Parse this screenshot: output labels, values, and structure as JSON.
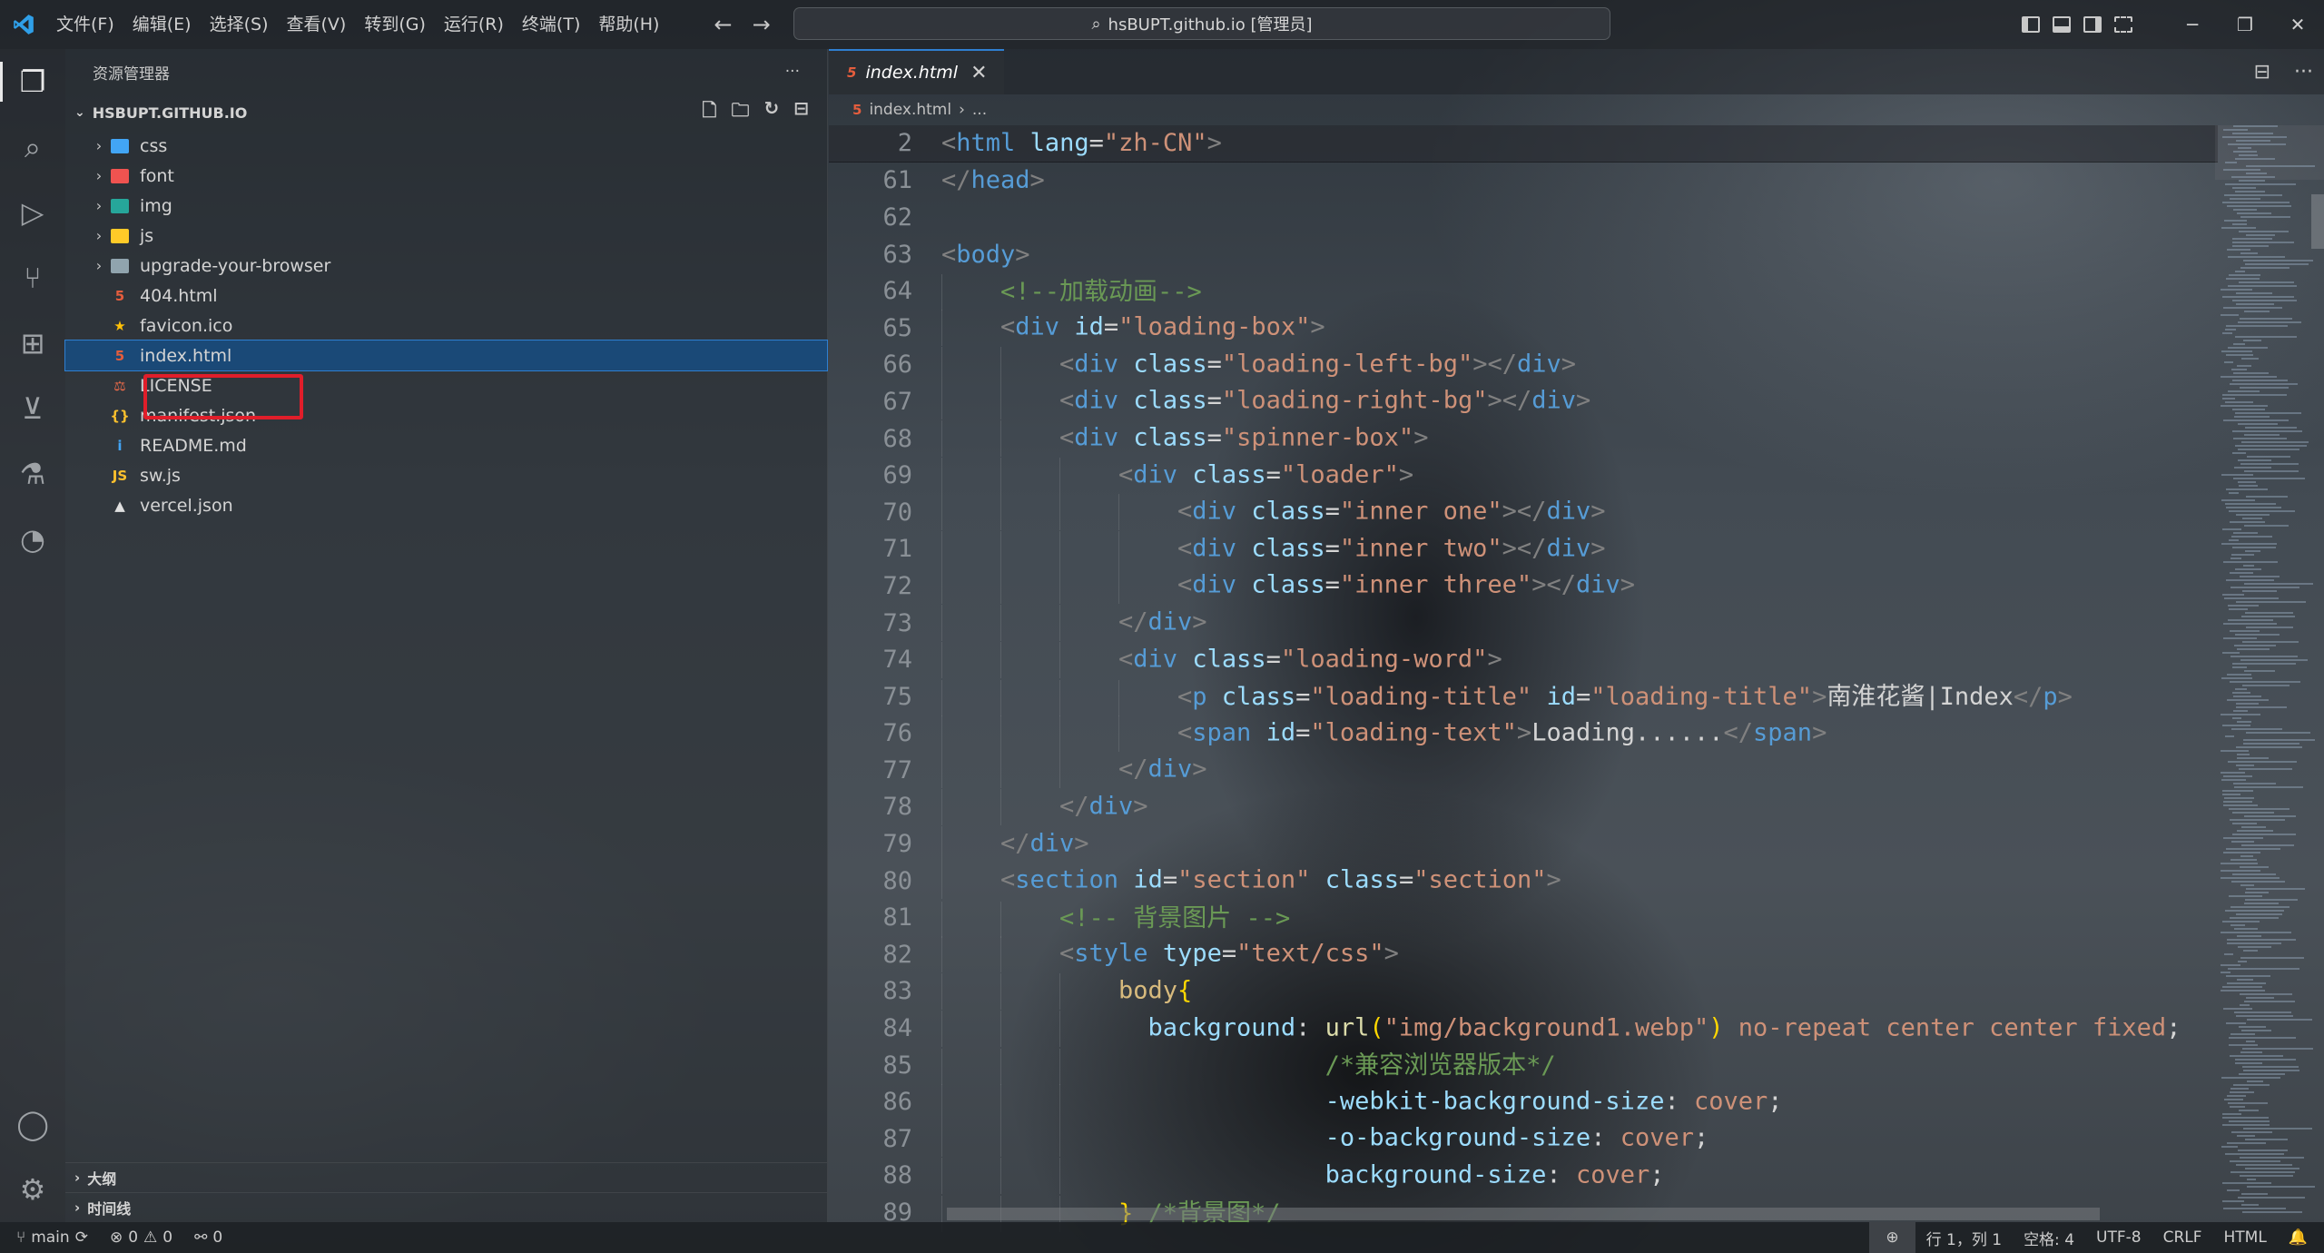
{
  "titlebar": {
    "menu": [
      "文件(F)",
      "编辑(E)",
      "选择(S)",
      "查看(V)",
      "转到(G)",
      "运行(R)",
      "终端(T)",
      "帮助(H)"
    ],
    "back_arrow": "←",
    "forward_arrow": "→",
    "search_text": "hsBUPT.github.io [管理员]",
    "minimize": "─",
    "restore": "❐",
    "close": "✕"
  },
  "activity": {
    "items": [
      "explorer-icon",
      "search-icon",
      "run-debug-icon",
      "source-control-icon",
      "extensions-icon",
      "remote-explorer-icon",
      "testing-icon",
      "live-share-icon"
    ],
    "bottom": [
      "account-icon",
      "settings-gear-icon"
    ]
  },
  "sidebar": {
    "title": "资源管理器",
    "more": "···",
    "root": "HSBUPT.GITHUB.IO",
    "tree": [
      {
        "label": "css",
        "type": "folder",
        "color": "#42a5f5"
      },
      {
        "label": "font",
        "type": "folder",
        "color": "#ef5350"
      },
      {
        "label": "img",
        "type": "folder",
        "color": "#26a69a"
      },
      {
        "label": "js",
        "type": "folder",
        "color": "#ffca28"
      },
      {
        "label": "upgrade-your-browser",
        "type": "folder",
        "color": "#90a4ae"
      },
      {
        "label": "404.html",
        "type": "html",
        "glyph": "5",
        "color": "#e45d3d"
      },
      {
        "label": "favicon.ico",
        "type": "file",
        "glyph": "★",
        "color": "#ffc107"
      },
      {
        "label": "index.html",
        "type": "html",
        "glyph": "5",
        "color": "#e45d3d",
        "selected": true
      },
      {
        "label": "LICENSE",
        "type": "file",
        "glyph": "⚖",
        "color": "#ef6c4a"
      },
      {
        "label": "manifest.json",
        "type": "file",
        "glyph": "{}",
        "color": "#fbc02d"
      },
      {
        "label": "README.md",
        "type": "file",
        "glyph": "i",
        "color": "#42a5f5"
      },
      {
        "label": "sw.js",
        "type": "file",
        "glyph": "JS",
        "color": "#fbc02d"
      },
      {
        "label": "vercel.json",
        "type": "file",
        "glyph": "▲",
        "color": "#e0e0e0"
      }
    ],
    "outline": "大纲",
    "timeline": "时间线"
  },
  "editor": {
    "tab_label": "index.html",
    "tab_close": "✕",
    "breadcrumb_file": "index.html",
    "breadcrumb_sep": "›",
    "breadcrumb_more": "...",
    "lines": [
      {
        "n": "2",
        "indent": 0,
        "tokens": [
          [
            "t-br",
            "<"
          ],
          [
            "t-tag",
            "html"
          ],
          [
            "t-txt",
            " "
          ],
          [
            "t-attr",
            "lang"
          ],
          [
            "t-txt",
            "="
          ],
          [
            "t-str",
            "\"zh-CN\""
          ],
          [
            "t-br",
            ">"
          ]
        ]
      },
      {
        "n": "61",
        "indent": 0,
        "tokens": [
          [
            "t-br",
            "</"
          ],
          [
            "t-tag",
            "head"
          ],
          [
            "t-br",
            ">"
          ]
        ]
      },
      {
        "n": "62",
        "indent": 0,
        "tokens": []
      },
      {
        "n": "63",
        "indent": 0,
        "tokens": [
          [
            "t-br",
            "<"
          ],
          [
            "t-tag",
            "body"
          ],
          [
            "t-br",
            ">"
          ]
        ]
      },
      {
        "n": "64",
        "indent": 1,
        "tokens": [
          [
            "t-com",
            "<!--加载动画-->"
          ]
        ]
      },
      {
        "n": "65",
        "indent": 1,
        "tokens": [
          [
            "t-br",
            "<"
          ],
          [
            "t-tag",
            "div"
          ],
          [
            "t-txt",
            " "
          ],
          [
            "t-attr",
            "id"
          ],
          [
            "t-txt",
            "="
          ],
          [
            "t-str",
            "\"loading-box\""
          ],
          [
            "t-br",
            ">"
          ]
        ]
      },
      {
        "n": "66",
        "indent": 2,
        "tokens": [
          [
            "t-br",
            "<"
          ],
          [
            "t-tag",
            "div"
          ],
          [
            "t-txt",
            " "
          ],
          [
            "t-attr",
            "class"
          ],
          [
            "t-txt",
            "="
          ],
          [
            "t-str",
            "\"loading-left-bg\""
          ],
          [
            "t-br",
            "></"
          ],
          [
            "t-tag",
            "div"
          ],
          [
            "t-br",
            ">"
          ]
        ]
      },
      {
        "n": "67",
        "indent": 2,
        "tokens": [
          [
            "t-br",
            "<"
          ],
          [
            "t-tag",
            "div"
          ],
          [
            "t-txt",
            " "
          ],
          [
            "t-attr",
            "class"
          ],
          [
            "t-txt",
            "="
          ],
          [
            "t-str",
            "\"loading-right-bg\""
          ],
          [
            "t-br",
            "></"
          ],
          [
            "t-tag",
            "div"
          ],
          [
            "t-br",
            ">"
          ]
        ]
      },
      {
        "n": "68",
        "indent": 2,
        "tokens": [
          [
            "t-br",
            "<"
          ],
          [
            "t-tag",
            "div"
          ],
          [
            "t-txt",
            " "
          ],
          [
            "t-attr",
            "class"
          ],
          [
            "t-txt",
            "="
          ],
          [
            "t-str",
            "\"spinner-box\""
          ],
          [
            "t-br",
            ">"
          ]
        ]
      },
      {
        "n": "69",
        "indent": 3,
        "tokens": [
          [
            "t-br",
            "<"
          ],
          [
            "t-tag",
            "div"
          ],
          [
            "t-txt",
            " "
          ],
          [
            "t-attr",
            "class"
          ],
          [
            "t-txt",
            "="
          ],
          [
            "t-str",
            "\"loader\""
          ],
          [
            "t-br",
            ">"
          ]
        ]
      },
      {
        "n": "70",
        "indent": 4,
        "tokens": [
          [
            "t-br",
            "<"
          ],
          [
            "t-tag",
            "div"
          ],
          [
            "t-txt",
            " "
          ],
          [
            "t-attr",
            "class"
          ],
          [
            "t-txt",
            "="
          ],
          [
            "t-str",
            "\"inner one\""
          ],
          [
            "t-br",
            "></"
          ],
          [
            "t-tag",
            "div"
          ],
          [
            "t-br",
            ">"
          ]
        ]
      },
      {
        "n": "71",
        "indent": 4,
        "tokens": [
          [
            "t-br",
            "<"
          ],
          [
            "t-tag",
            "div"
          ],
          [
            "t-txt",
            " "
          ],
          [
            "t-attr",
            "class"
          ],
          [
            "t-txt",
            "="
          ],
          [
            "t-str",
            "\"inner two\""
          ],
          [
            "t-br",
            "></"
          ],
          [
            "t-tag",
            "div"
          ],
          [
            "t-br",
            ">"
          ]
        ]
      },
      {
        "n": "72",
        "indent": 4,
        "tokens": [
          [
            "t-br",
            "<"
          ],
          [
            "t-tag",
            "div"
          ],
          [
            "t-txt",
            " "
          ],
          [
            "t-attr",
            "class"
          ],
          [
            "t-txt",
            "="
          ],
          [
            "t-str",
            "\"inner three\""
          ],
          [
            "t-br",
            "></"
          ],
          [
            "t-tag",
            "div"
          ],
          [
            "t-br",
            ">"
          ]
        ]
      },
      {
        "n": "73",
        "indent": 3,
        "tokens": [
          [
            "t-br",
            "</"
          ],
          [
            "t-tag",
            "div"
          ],
          [
            "t-br",
            ">"
          ]
        ]
      },
      {
        "n": "74",
        "indent": 3,
        "tokens": [
          [
            "t-br",
            "<"
          ],
          [
            "t-tag",
            "div"
          ],
          [
            "t-txt",
            " "
          ],
          [
            "t-attr",
            "class"
          ],
          [
            "t-txt",
            "="
          ],
          [
            "t-str",
            "\"loading-word\""
          ],
          [
            "t-br",
            ">"
          ]
        ]
      },
      {
        "n": "75",
        "indent": 4,
        "tokens": [
          [
            "t-br",
            "<"
          ],
          [
            "t-tag",
            "p"
          ],
          [
            "t-txt",
            " "
          ],
          [
            "t-attr",
            "class"
          ],
          [
            "t-txt",
            "="
          ],
          [
            "t-str",
            "\"loading-title\""
          ],
          [
            "t-txt",
            " "
          ],
          [
            "t-attr",
            "id"
          ],
          [
            "t-txt",
            "="
          ],
          [
            "t-str",
            "\"loading-title\""
          ],
          [
            "t-br",
            ">"
          ],
          [
            "t-txt",
            "南淮花酱|Index"
          ],
          [
            "t-br",
            "</"
          ],
          [
            "t-tag",
            "p"
          ],
          [
            "t-br",
            ">"
          ]
        ]
      },
      {
        "n": "76",
        "indent": 4,
        "tokens": [
          [
            "t-br",
            "<"
          ],
          [
            "t-tag",
            "span"
          ],
          [
            "t-txt",
            " "
          ],
          [
            "t-attr",
            "id"
          ],
          [
            "t-txt",
            "="
          ],
          [
            "t-str",
            "\"loading-text\""
          ],
          [
            "t-br",
            ">"
          ],
          [
            "t-txt",
            "Loading......"
          ],
          [
            "t-br",
            "</"
          ],
          [
            "t-tag",
            "span"
          ],
          [
            "t-br",
            ">"
          ]
        ]
      },
      {
        "n": "77",
        "indent": 3,
        "tokens": [
          [
            "t-br",
            "</"
          ],
          [
            "t-tag",
            "div"
          ],
          [
            "t-br",
            ">"
          ]
        ]
      },
      {
        "n": "78",
        "indent": 2,
        "tokens": [
          [
            "t-br",
            "</"
          ],
          [
            "t-tag",
            "div"
          ],
          [
            "t-br",
            ">"
          ]
        ]
      },
      {
        "n": "79",
        "indent": 1,
        "tokens": [
          [
            "t-br",
            "</"
          ],
          [
            "t-tag",
            "div"
          ],
          [
            "t-br",
            ">"
          ]
        ]
      },
      {
        "n": "80",
        "indent": 1,
        "tokens": [
          [
            "t-br",
            "<"
          ],
          [
            "t-tag",
            "section"
          ],
          [
            "t-txt",
            " "
          ],
          [
            "t-attr",
            "id"
          ],
          [
            "t-txt",
            "="
          ],
          [
            "t-str",
            "\"section\""
          ],
          [
            "t-txt",
            " "
          ],
          [
            "t-attr",
            "class"
          ],
          [
            "t-txt",
            "="
          ],
          [
            "t-str",
            "\"section\""
          ],
          [
            "t-br",
            ">"
          ]
        ]
      },
      {
        "n": "81",
        "indent": 2,
        "tokens": [
          [
            "t-com",
            "<!-- 背景图片 -->"
          ]
        ]
      },
      {
        "n": "82",
        "indent": 2,
        "tokens": [
          [
            "t-br",
            "<"
          ],
          [
            "t-tag",
            "style"
          ],
          [
            "t-txt",
            " "
          ],
          [
            "t-attr",
            "type"
          ],
          [
            "t-txt",
            "="
          ],
          [
            "t-str",
            "\"text/css\""
          ],
          [
            "t-br",
            ">"
          ]
        ]
      },
      {
        "n": "83",
        "indent": 3,
        "tokens": [
          [
            "t-sel",
            "body"
          ],
          [
            "t-brace",
            "{"
          ]
        ]
      },
      {
        "n": "84",
        "indent": 3,
        "pad": "  ",
        "tokens": [
          [
            "t-prop",
            "background"
          ],
          [
            "t-txt",
            ": "
          ],
          [
            "t-fn",
            "url"
          ],
          [
            "t-brace",
            "("
          ],
          [
            "t-str",
            "\"img/background1.webp\""
          ],
          [
            "t-brace",
            ")"
          ],
          [
            "t-str",
            " no-repeat center center fixed"
          ],
          [
            "t-txt",
            ";"
          ]
        ]
      },
      {
        "n": "85",
        "indent": 3,
        "pad": "              ",
        "tokens": [
          [
            "t-com",
            "/*兼容浏览器版本*/"
          ]
        ]
      },
      {
        "n": "86",
        "indent": 3,
        "pad": "              ",
        "tokens": [
          [
            "t-prop",
            "-webkit-background-size"
          ],
          [
            "t-txt",
            ": "
          ],
          [
            "t-str",
            "cover"
          ],
          [
            "t-txt",
            ";"
          ]
        ]
      },
      {
        "n": "87",
        "indent": 3,
        "pad": "              ",
        "tokens": [
          [
            "t-prop",
            "-o-background-size"
          ],
          [
            "t-txt",
            ": "
          ],
          [
            "t-str",
            "cover"
          ],
          [
            "t-txt",
            ";"
          ]
        ]
      },
      {
        "n": "88",
        "indent": 3,
        "pad": "              ",
        "tokens": [
          [
            "t-prop",
            "background-size"
          ],
          [
            "t-txt",
            ": "
          ],
          [
            "t-str",
            "cover"
          ],
          [
            "t-txt",
            ";"
          ]
        ]
      },
      {
        "n": "89",
        "indent": 3,
        "tokens": [
          [
            "t-brace",
            "}"
          ],
          [
            "t-txt",
            " "
          ],
          [
            "t-com",
            "/*背景图*/"
          ]
        ]
      }
    ]
  },
  "statusbar": {
    "branch": "main",
    "sync": "⟳",
    "errors": "0",
    "warnings": "0",
    "ports": "0",
    "position": "行 1，列 1",
    "spaces": "空格: 4",
    "encoding": "UTF-8",
    "eol": "CRLF",
    "language": "HTML"
  }
}
